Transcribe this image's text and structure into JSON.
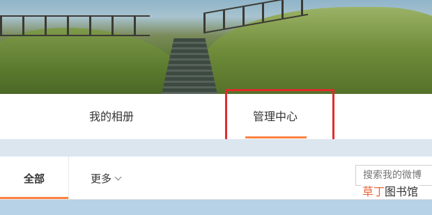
{
  "banner": {
    "alt": "scenic cover photo"
  },
  "nav": {
    "tabs": [
      {
        "label": "我的相册"
      },
      {
        "label": "管理中心"
      }
    ]
  },
  "subnav": {
    "all_label": "全部",
    "more_label": "更多",
    "search_placeholder": "搜索我的微博"
  },
  "watermark": {
    "accent": "草丁",
    "rest": "图书馆"
  },
  "colors": {
    "accent": "#ff8140",
    "highlight": "#e02b2b"
  }
}
